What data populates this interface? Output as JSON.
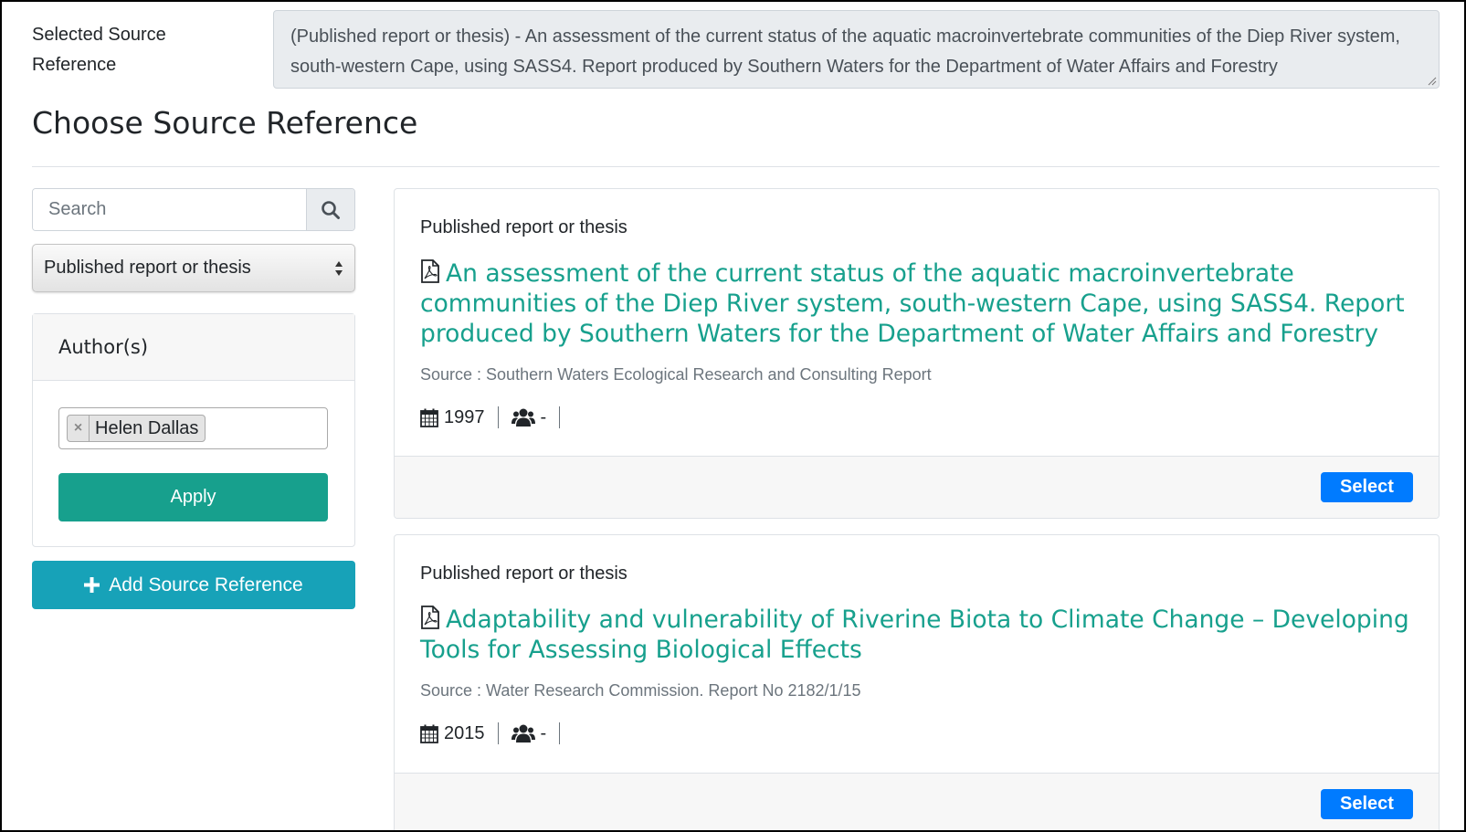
{
  "selected": {
    "label": "Selected Source Reference",
    "value": "(Published report or thesis) - An assessment of the current status of the aquatic macroinvertebrate communities of the Diep River system, south-western Cape, using SASS4. Report produced by Southern Waters for the Department of Water Affairs and Forestry"
  },
  "page": {
    "heading": "Choose Source Reference"
  },
  "sidebar": {
    "search": {
      "placeholder": "Search",
      "icon": "search-icon"
    },
    "type_select": {
      "value": "Published report or thesis"
    },
    "author_filter": {
      "header": "Author(s)",
      "tags": [
        {
          "label": "Helen Dallas",
          "remove": "×"
        }
      ],
      "apply_label": "Apply"
    },
    "add_button": {
      "label": "Add Source Reference",
      "icon": "plus-icon"
    }
  },
  "results": [
    {
      "type": "Published report or thesis",
      "title": "An assessment of the current status of the aquatic macroinvertebrate communities of the Diep River system, south-western Cape, using SASS4. Report produced by Southern Waters for the Department of Water Affairs and Forestry",
      "source": "Source : Southern Waters Ecological Research and Consulting Report",
      "year": "1997",
      "authors": "-",
      "select_label": "Select"
    },
    {
      "type": "Published report or thesis",
      "title": "Adaptability and vulnerability of Riverine Biota to Climate Change – Developing Tools for Assessing Biological Effects",
      "source": "Source : Water Research Commission. Report No 2182/1/15",
      "year": "2015",
      "authors": "-",
      "select_label": "Select"
    }
  ],
  "colors": {
    "title_accent": "#17a08d",
    "apply_button": "#17a08d",
    "add_button": "#17a2b8",
    "select_button": "#007bff"
  }
}
